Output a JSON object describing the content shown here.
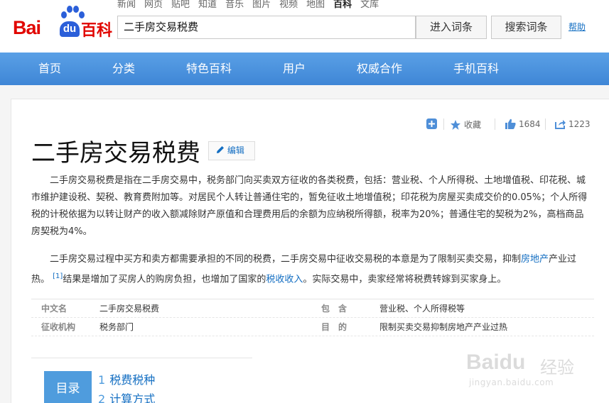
{
  "header": {
    "logo_text": "Bai du 百科",
    "logo_bai": "Bai",
    "logo_du": "du",
    "logo_baike": "百科",
    "nav_links": [
      "新闻",
      "网页",
      "贴吧",
      "知道",
      "音乐",
      "图片",
      "视频",
      "地图",
      "百科",
      "文库"
    ],
    "active_link": "百科",
    "search_value": "二手房交易税费",
    "enter_button": "进入词条",
    "search_button": "搜索词条",
    "help_link": "帮助"
  },
  "main_nav": [
    "首页",
    "分类",
    "特色百科",
    "用户",
    "权威合作",
    "手机百科"
  ],
  "toolbar": {
    "favorite_label": "收藏",
    "like_count": "1684",
    "share_count": "1223"
  },
  "article": {
    "title": "二手房交易税费",
    "edit_label": "编辑",
    "para1": "二手房交易税费是指在二手房交易中，税务部门向买卖双方征收的各类税费，包括：营业税、个人所得税、土地增值税、印花税、城市维护建设税、契税、教育费附加等。对居民个人转让普通住宅的，暂免征收土地增值税；印花税为房屋买卖成交价的0.05%；个人所得税的计税依据为以转让财产的收入额减除财产原值和合理费用后的余额为应纳税所得额，税率为20%；普通住宅的契税为2%，高档商品房契税为4%。",
    "para2_a": "二手房交易过程中买方和卖方都需要承担的不同的税费，二手房交易中征收交易税的本意是为了限制买卖交易，抑制",
    "para2_link1": "房地产",
    "para2_b": "产业过热。",
    "para2_ref": "[1]",
    "para2_c": "结果是增加了买房人的购房负担，也增加了国家的",
    "para2_link2": "税收收入",
    "para2_d": "。实际交易中，卖家经常将税费转嫁到买家身上。"
  },
  "basic_info": {
    "row1": {
      "k1": "中文名",
      "v1": "二手房交易税费",
      "k2": "包　含",
      "v2": "营业税、个人所得税等"
    },
    "row2": {
      "k1": "征收机构",
      "v1": "税务部门",
      "k2": "目　的",
      "v2": "限制买卖交易抑制房地产产业过热"
    }
  },
  "toc": {
    "label": "目录",
    "items": [
      {
        "num": "1",
        "text": "税费税种"
      },
      {
        "num": "2",
        "text": "计算方式"
      }
    ]
  },
  "watermark": {
    "brand": "Baidu",
    "product": "经验",
    "url": "jingyan.baidu.com"
  }
}
